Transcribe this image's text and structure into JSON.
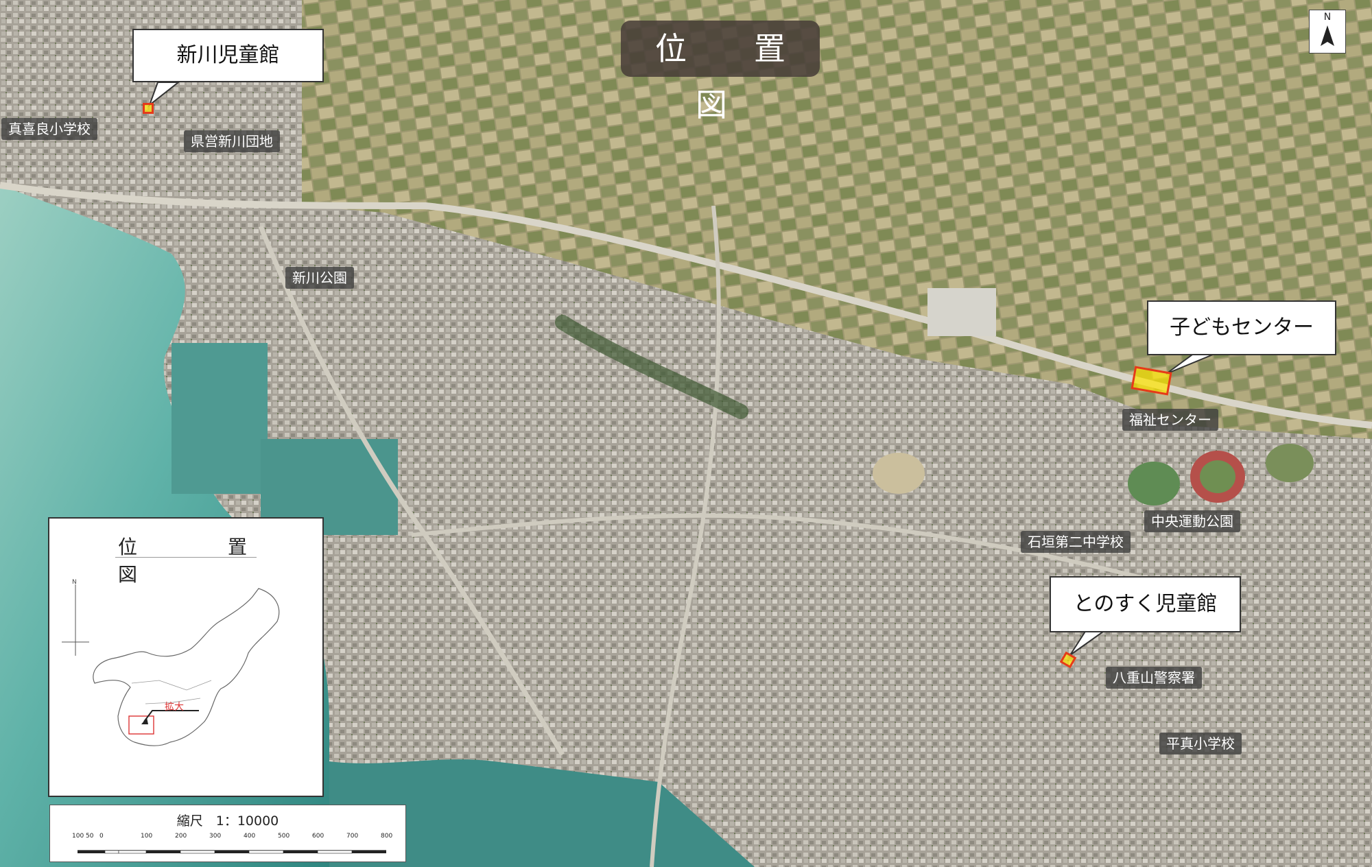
{
  "title": "位　置　図",
  "north_label": "N",
  "callouts": {
    "arakawa": "新川児童館",
    "kodomo": "子どもセンター",
    "tonosuku": "とのすく児童館"
  },
  "labels": {
    "makira": "真喜良小学校",
    "kenei": "県営新川団地",
    "arakawa_park": "新川公園",
    "fukushi": "福祉センター",
    "chuo_park": "中央運動公園",
    "ishigaki2": "石垣第二中学校",
    "yaeyama_police": "八重山警察署",
    "hirama": "平真小学校"
  },
  "inset": {
    "title": "位　置　図",
    "north": "N",
    "highlight_label": "拡大"
  },
  "scale": {
    "label": "縮尺　1：10000",
    "ticks": [
      "100",
      "50",
      "0",
      "100",
      "200",
      "300",
      "400",
      "500",
      "600",
      "700",
      "800"
    ]
  },
  "colors": {
    "sea_light": "#63b7ad",
    "sea_dark": "#3c8f88",
    "urban": "#a9a59c",
    "farmland": "#9f9a6f",
    "road": "#d6d2c6",
    "site_fill": "#ffe600",
    "site_border": "#e53a1a"
  }
}
